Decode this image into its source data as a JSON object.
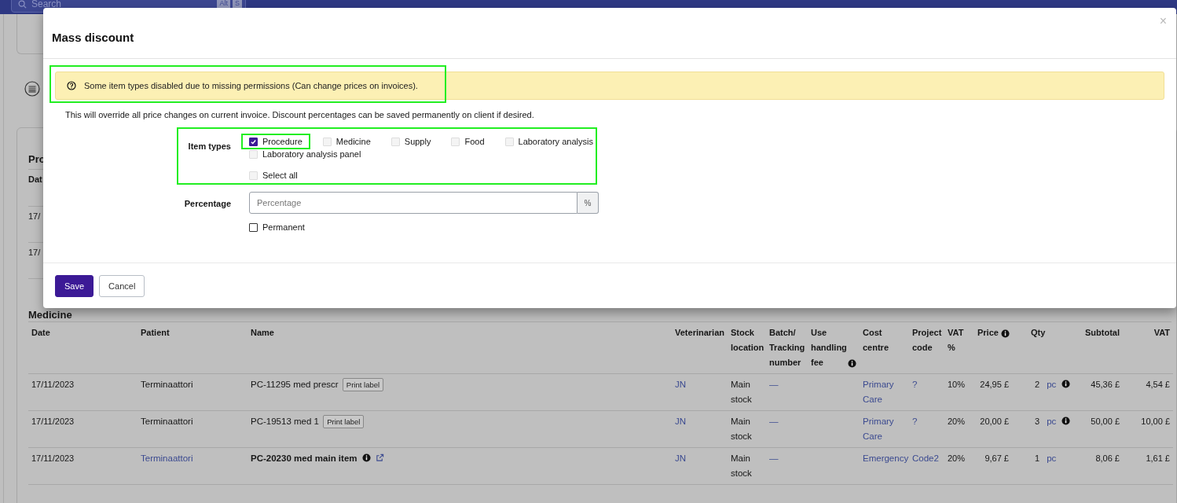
{
  "top_bar": {
    "search": {
      "placeholder": "Search"
    },
    "shortcut_keys": [
      "Alt",
      "S"
    ]
  },
  "procedure_section": {
    "heading": "Pro",
    "column": "Dat",
    "rows": [
      "17/",
      "17/"
    ]
  },
  "modal": {
    "title": "Mass discount",
    "close": "×",
    "alert": {
      "text": "Some item types disabled due to missing permissions (Can change prices on invoices).",
      "highlighted": true
    },
    "description": "This will override all price changes on current invoice. Discount percentages can be saved permanently on client if desired.",
    "item_types": {
      "label": "Item types",
      "highlighted": true,
      "items": [
        {
          "label": "Procedure",
          "checked": true,
          "disabled": false,
          "highlighted": true
        },
        {
          "label": "Medicine",
          "checked": false,
          "disabled": true,
          "highlighted": false
        },
        {
          "label": "Supply",
          "checked": false,
          "disabled": true,
          "highlighted": false
        },
        {
          "label": "Food",
          "checked": false,
          "disabled": true,
          "highlighted": false
        },
        {
          "label": "Laboratory analysis",
          "checked": false,
          "disabled": true,
          "highlighted": false
        },
        {
          "label": "Laboratory analysis panel",
          "checked": false,
          "disabled": true,
          "highlighted": false
        }
      ],
      "select_all": {
        "label": "Select all",
        "checked": false,
        "disabled": true
      }
    },
    "percentage": {
      "label": "Percentage",
      "placeholder": "Percentage",
      "unit": "%"
    },
    "permanent": {
      "label": "Permanent",
      "checked": false,
      "disabled": false
    },
    "buttons": [
      {
        "label": "Save",
        "kind": "primary"
      },
      {
        "label": "Cancel",
        "kind": "secondary"
      }
    ]
  },
  "medicine": {
    "heading": "Medicine",
    "columns": [
      {
        "label": "Date",
        "info": false
      },
      {
        "label": "Patient",
        "info": false
      },
      {
        "label": "Name",
        "info": false
      },
      {
        "label": "Veterinarian",
        "info": false
      },
      {
        "label": "Stock location",
        "info": false
      },
      {
        "label": "Batch/ Tracking number",
        "info": false
      },
      {
        "label": "Use handling fee",
        "info": true
      },
      {
        "label": "Cost centre",
        "info": false
      },
      {
        "label": "Project code",
        "info": false
      },
      {
        "label": "VAT %",
        "info": false
      },
      {
        "label": "Price",
        "info": true
      },
      {
        "label": "Qty",
        "info": false
      },
      {
        "label": "Subtotal",
        "info": false
      },
      {
        "label": "VAT",
        "info": false
      }
    ],
    "rows": [
      {
        "date": "17/11/2023",
        "patient": "Terminaattori",
        "patient_linked": false,
        "name": "PC-11295 med prescr",
        "kind": "print",
        "print_label": "Print label",
        "veterinarian": "JN",
        "stock_location": "Main stock",
        "batch": "—",
        "cost_centre": "Primary Care",
        "project_code": "?",
        "vat": "10%",
        "price": "24,95 £",
        "qty": "2",
        "unit": "pc",
        "unit_info": true,
        "subtotal": "45,36 £",
        "vat_amount": "4,54 £"
      },
      {
        "date": "17/11/2023",
        "patient": "Terminaattori",
        "patient_linked": false,
        "name": "PC-19513 med 1",
        "kind": "print",
        "print_label": "Print label",
        "veterinarian": "JN",
        "stock_location": "Main stock",
        "batch": "—",
        "cost_centre": "Primary Care",
        "project_code": "?",
        "vat": "20%",
        "price": "20,00 £",
        "qty": "3",
        "unit": "pc",
        "unit_info": true,
        "subtotal": "50,00 £",
        "vat_amount": "10,00 £"
      },
      {
        "date": "17/11/2023",
        "patient": "Terminaattori",
        "patient_linked": true,
        "name": "PC-20230 med main item",
        "kind": "main",
        "veterinarian": "JN",
        "stock_location": "Main stock",
        "batch": "—",
        "cost_centre": "Emergency",
        "project_code": "Code2",
        "vat": "20%",
        "price": "9,67 £",
        "qty": "1",
        "unit": "pc",
        "unit_info": false,
        "subtotal": "8,06 £",
        "vat_amount": "1,61 £"
      }
    ]
  }
}
